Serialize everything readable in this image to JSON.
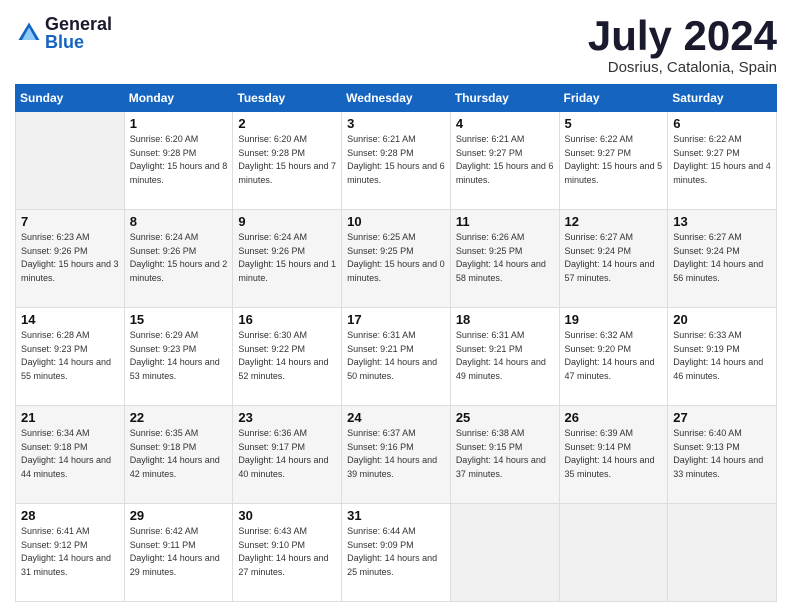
{
  "header": {
    "logo_general": "General",
    "logo_blue": "Blue",
    "month_title": "July 2024",
    "location": "Dosrius, Catalonia, Spain"
  },
  "calendar": {
    "days_header": [
      "Sunday",
      "Monday",
      "Tuesday",
      "Wednesday",
      "Thursday",
      "Friday",
      "Saturday"
    ],
    "weeks": [
      {
        "days": [
          {
            "empty": true
          },
          {
            "number": "1",
            "sunrise": "6:20 AM",
            "sunset": "9:28 PM",
            "daylight": "15 hours and 8 minutes."
          },
          {
            "number": "2",
            "sunrise": "6:20 AM",
            "sunset": "9:28 PM",
            "daylight": "15 hours and 7 minutes."
          },
          {
            "number": "3",
            "sunrise": "6:21 AM",
            "sunset": "9:28 PM",
            "daylight": "15 hours and 6 minutes."
          },
          {
            "number": "4",
            "sunrise": "6:21 AM",
            "sunset": "9:27 PM",
            "daylight": "15 hours and 6 minutes."
          },
          {
            "number": "5",
            "sunrise": "6:22 AM",
            "sunset": "9:27 PM",
            "daylight": "15 hours and 5 minutes."
          },
          {
            "number": "6",
            "sunrise": "6:22 AM",
            "sunset": "9:27 PM",
            "daylight": "15 hours and 4 minutes."
          }
        ]
      },
      {
        "days": [
          {
            "number": "7",
            "sunrise": "6:23 AM",
            "sunset": "9:26 PM",
            "daylight": "15 hours and 3 minutes."
          },
          {
            "number": "8",
            "sunrise": "6:24 AM",
            "sunset": "9:26 PM",
            "daylight": "15 hours and 2 minutes."
          },
          {
            "number": "9",
            "sunrise": "6:24 AM",
            "sunset": "9:26 PM",
            "daylight": "15 hours and 1 minute."
          },
          {
            "number": "10",
            "sunrise": "6:25 AM",
            "sunset": "9:25 PM",
            "daylight": "15 hours and 0 minutes."
          },
          {
            "number": "11",
            "sunrise": "6:26 AM",
            "sunset": "9:25 PM",
            "daylight": "14 hours and 58 minutes."
          },
          {
            "number": "12",
            "sunrise": "6:27 AM",
            "sunset": "9:24 PM",
            "daylight": "14 hours and 57 minutes."
          },
          {
            "number": "13",
            "sunrise": "6:27 AM",
            "sunset": "9:24 PM",
            "daylight": "14 hours and 56 minutes."
          }
        ]
      },
      {
        "days": [
          {
            "number": "14",
            "sunrise": "6:28 AM",
            "sunset": "9:23 PM",
            "daylight": "14 hours and 55 minutes."
          },
          {
            "number": "15",
            "sunrise": "6:29 AM",
            "sunset": "9:23 PM",
            "daylight": "14 hours and 53 minutes."
          },
          {
            "number": "16",
            "sunrise": "6:30 AM",
            "sunset": "9:22 PM",
            "daylight": "14 hours and 52 minutes."
          },
          {
            "number": "17",
            "sunrise": "6:31 AM",
            "sunset": "9:21 PM",
            "daylight": "14 hours and 50 minutes."
          },
          {
            "number": "18",
            "sunrise": "6:31 AM",
            "sunset": "9:21 PM",
            "daylight": "14 hours and 49 minutes."
          },
          {
            "number": "19",
            "sunrise": "6:32 AM",
            "sunset": "9:20 PM",
            "daylight": "14 hours and 47 minutes."
          },
          {
            "number": "20",
            "sunrise": "6:33 AM",
            "sunset": "9:19 PM",
            "daylight": "14 hours and 46 minutes."
          }
        ]
      },
      {
        "days": [
          {
            "number": "21",
            "sunrise": "6:34 AM",
            "sunset": "9:18 PM",
            "daylight": "14 hours and 44 minutes."
          },
          {
            "number": "22",
            "sunrise": "6:35 AM",
            "sunset": "9:18 PM",
            "daylight": "14 hours and 42 minutes."
          },
          {
            "number": "23",
            "sunrise": "6:36 AM",
            "sunset": "9:17 PM",
            "daylight": "14 hours and 40 minutes."
          },
          {
            "number": "24",
            "sunrise": "6:37 AM",
            "sunset": "9:16 PM",
            "daylight": "14 hours and 39 minutes."
          },
          {
            "number": "25",
            "sunrise": "6:38 AM",
            "sunset": "9:15 PM",
            "daylight": "14 hours and 37 minutes."
          },
          {
            "number": "26",
            "sunrise": "6:39 AM",
            "sunset": "9:14 PM",
            "daylight": "14 hours and 35 minutes."
          },
          {
            "number": "27",
            "sunrise": "6:40 AM",
            "sunset": "9:13 PM",
            "daylight": "14 hours and 33 minutes."
          }
        ]
      },
      {
        "days": [
          {
            "number": "28",
            "sunrise": "6:41 AM",
            "sunset": "9:12 PM",
            "daylight": "14 hours and 31 minutes."
          },
          {
            "number": "29",
            "sunrise": "6:42 AM",
            "sunset": "9:11 PM",
            "daylight": "14 hours and 29 minutes."
          },
          {
            "number": "30",
            "sunrise": "6:43 AM",
            "sunset": "9:10 PM",
            "daylight": "14 hours and 27 minutes."
          },
          {
            "number": "31",
            "sunrise": "6:44 AM",
            "sunset": "9:09 PM",
            "daylight": "14 hours and 25 minutes."
          },
          {
            "empty": true
          },
          {
            "empty": true
          },
          {
            "empty": true
          }
        ]
      }
    ]
  }
}
